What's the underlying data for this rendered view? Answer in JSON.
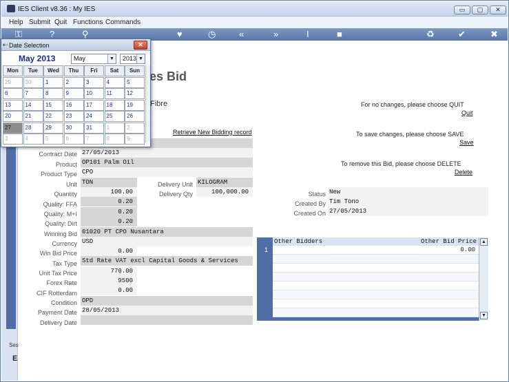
{
  "window": {
    "title": "IES Client v8.36 : My IES",
    "minimize": "▭",
    "maximize": "▢",
    "close": "✕"
  },
  "menu": [
    "Help",
    "Submit",
    "Quit",
    "Functions",
    "Commands"
  ],
  "toolbar_icons": [
    "key-icon",
    "help-icon",
    "search-icon",
    "heart-icon",
    "history-icon",
    "first-icon",
    "next-icon",
    "cursor-icon",
    "stop-icon",
    "recycle-icon",
    "check-icon",
    "close-icon"
  ],
  "page": {
    "title": "es Bid",
    "subtitle": "Fibre",
    "retrieve_link": "Retrieve New Bidding record"
  },
  "side": {
    "ses_label": "Ses",
    "icon_text": "E"
  },
  "actions": {
    "quit_text": "For no changes, please choose QUIT",
    "quit_link": "Quit",
    "save_text": "To save changes, please choose SAVE",
    "save_link": "Save",
    "delete_text": "To remove this Bid,  please choose  DELETE",
    "delete_link": "Delete"
  },
  "form": {
    "labels": {
      "contract_date": "Contract Date",
      "product": "Product",
      "product_type": "Product Type",
      "unit": "Unit",
      "quantity": "Quantity",
      "quality_ffa": "Quality: FFA",
      "quality_mi": "Quality: M+I",
      "quality_dirt": "Quality: Dirt",
      "winning_bid": "Winning Bid",
      "currency": "Currency",
      "win_bid_price": "Win Bid Price",
      "tax_type": "Tax Type",
      "unit_tax_price": "Unit Tax Price",
      "forex_rate": "Forex Rate",
      "cif_rotterdam": "CIF Rotterdam",
      "condition": "Condition",
      "payment_date": "Payment Date",
      "delivery_date": "Delivery Date",
      "delivery_unit": "Delivery Unit",
      "delivery_qty": "Delivery Qty",
      "status": "Status",
      "created_by": "Created By",
      "created_on": "Created On"
    },
    "values": {
      "contract_date": "27/05/2013",
      "product": "OP101 Palm Oil",
      "product_type": "CPO",
      "unit": "TON",
      "quantity": "100.00",
      "quality_ffa": "0.20",
      "quality_mi": "0.20",
      "quality_dirt": "0.20",
      "winning_bid": "01020 PT CPO Nusantara",
      "currency": "USD",
      "win_bid_price": "0.00",
      "tax_type": "Std Rate VAT excl Capital Goods & Services",
      "unit_tax_price": "770.00",
      "forex_rate": "9500",
      "cif_rotterdam": "0.00",
      "condition": "OPD",
      "payment_date": "28/05/2013",
      "delivery_date": "",
      "delivery_unit": "KILOGRAM",
      "delivery_qty": "100,000.00",
      "status": "New",
      "created_by": "Tim Tono",
      "created_on": "27/05/2013"
    }
  },
  "bidders_grid": {
    "headers": [
      "Other Bidders",
      "Other Bid Price"
    ],
    "rows": [
      {
        "num": "1",
        "bidder": "",
        "price": "0.00"
      }
    ]
  },
  "date_popup": {
    "title": "Date Selection",
    "close": "✕",
    "month_title": "May 2013",
    "month_select": "May",
    "year_select": "2013",
    "weekdays": [
      "Mon",
      "Tue",
      "Wed",
      "Thu",
      "Fri",
      "Sat",
      "Sun"
    ],
    "weeks": [
      [
        {
          "d": "29",
          "o": true
        },
        {
          "d": "30",
          "o": true
        },
        {
          "d": "1"
        },
        {
          "d": "2"
        },
        {
          "d": "3"
        },
        {
          "d": "4"
        },
        {
          "d": "5"
        }
      ],
      [
        {
          "d": "6"
        },
        {
          "d": "7"
        },
        {
          "d": "8"
        },
        {
          "d": "9"
        },
        {
          "d": "10"
        },
        {
          "d": "11"
        },
        {
          "d": "12"
        }
      ],
      [
        {
          "d": "13"
        },
        {
          "d": "14"
        },
        {
          "d": "15"
        },
        {
          "d": "16"
        },
        {
          "d": "17"
        },
        {
          "d": "18"
        },
        {
          "d": "19"
        }
      ],
      [
        {
          "d": "20"
        },
        {
          "d": "21"
        },
        {
          "d": "22"
        },
        {
          "d": "23"
        },
        {
          "d": "24"
        },
        {
          "d": "25"
        },
        {
          "d": "26"
        }
      ],
      [
        {
          "d": "27",
          "t": true
        },
        {
          "d": "28"
        },
        {
          "d": "29"
        },
        {
          "d": "30"
        },
        {
          "d": "31"
        },
        {
          "d": "1",
          "o": true
        },
        {
          "d": "2",
          "o": true
        }
      ],
      [
        {
          "d": "3",
          "o": true
        },
        {
          "d": "4",
          "o": true
        },
        {
          "d": "5",
          "o": true
        },
        {
          "d": "6",
          "o": true
        },
        {
          "d": "7",
          "o": true
        },
        {
          "d": "8",
          "o": true
        },
        {
          "d": "9",
          "o": true
        }
      ]
    ]
  }
}
